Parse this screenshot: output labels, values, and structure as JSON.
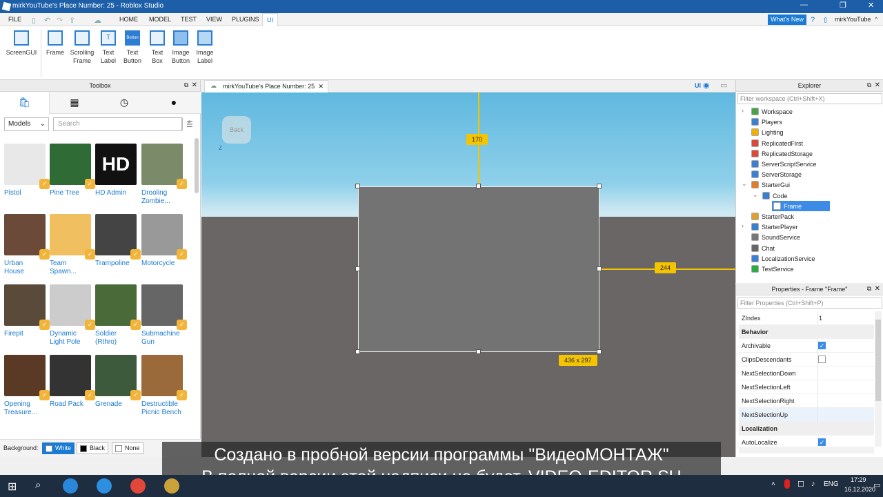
{
  "window": {
    "title": "mirkYouTube's Place Number: 25 - Roblox Studio",
    "minimize": "—",
    "restore": "❐",
    "close": "✕"
  },
  "menubar": {
    "items": [
      "FILE",
      "HOME",
      "MODEL",
      "TEST",
      "VIEW",
      "PLUGINS",
      "UI"
    ],
    "whats_new": "What's New",
    "user": "mirkYouTube"
  },
  "ribbon": {
    "buttons": [
      {
        "label1": "ScreenGUI",
        "label2": ""
      },
      {
        "label1": "Frame",
        "label2": ""
      },
      {
        "label1": "Scrolling",
        "label2": "Frame"
      },
      {
        "label1": "Text",
        "label2": "Label"
      },
      {
        "label1": "Text",
        "label2": "Button"
      },
      {
        "label1": "Text",
        "label2": "Box"
      },
      {
        "label1": "Image",
        "label2": "Button"
      },
      {
        "label1": "Image",
        "label2": "Label"
      }
    ],
    "text_button_icon_text": "Button"
  },
  "toolbox": {
    "title": "Toolbox",
    "category": "Models",
    "search_placeholder": "Search",
    "items": [
      {
        "label": "Pistol",
        "label2": ""
      },
      {
        "label": "Pine Tree",
        "label2": ""
      },
      {
        "label": "HD Admin",
        "label2": ""
      },
      {
        "label": "Drooling",
        "label2": "Zombie..."
      },
      {
        "label": "Urban",
        "label2": "House"
      },
      {
        "label": "Team",
        "label2": "Spawn..."
      },
      {
        "label": "Trampoline",
        "label2": ""
      },
      {
        "label": "Motorcycle",
        "label2": ""
      },
      {
        "label": "Firepit",
        "label2": ""
      },
      {
        "label": "Dynamic",
        "label2": "Light Pole"
      },
      {
        "label": "Soldier",
        "label2": "(Rthro)"
      },
      {
        "label": "Submachine",
        "label2": "Gun"
      },
      {
        "label": "Opening",
        "label2": "Treasure..."
      },
      {
        "label": "Road Pack",
        "label2": ""
      },
      {
        "label": "Grenade",
        "label2": ""
      },
      {
        "label": "Destructible",
        "label2": "Picnic Bench"
      }
    ],
    "hd_text": "HD",
    "background_label": "Background:",
    "bg_options": [
      "White",
      "Black",
      "None"
    ]
  },
  "viewport": {
    "tab_title": "mirkYouTube's Place Number: 25",
    "back_text": "Back",
    "axis_z": "Z",
    "top_distance": "170",
    "right_distance": "244",
    "size_label": "436 x 297",
    "ui_toggle": "UI"
  },
  "explorer": {
    "title": "Explorer",
    "filter_placeholder": "Filter workspace (Ctrl+Shift+X)",
    "items": [
      {
        "label": "Workspace",
        "color": "#4aa34a"
      },
      {
        "label": "Players",
        "color": "#3c7fd1"
      },
      {
        "label": "Lighting",
        "color": "#f0b000"
      },
      {
        "label": "ReplicatedFirst",
        "color": "#d84a3a"
      },
      {
        "label": "ReplicatedStorage",
        "color": "#d84a3a"
      },
      {
        "label": "ServerScriptService",
        "color": "#3c7fd1"
      },
      {
        "label": "ServerStorage",
        "color": "#3c7fd1"
      },
      {
        "label": "StarterGui",
        "color": "#e07b2a"
      },
      {
        "label": "Code",
        "color": "#3c7fd1"
      },
      {
        "label": "Frame",
        "color": "#ffffff"
      },
      {
        "label": "StarterPack",
        "color": "#e0a030"
      },
      {
        "label": "StarterPlayer",
        "color": "#3c7fd1"
      },
      {
        "label": "SoundService",
        "color": "#777777"
      },
      {
        "label": "Chat",
        "color": "#666666"
      },
      {
        "label": "LocalizationService",
        "color": "#3c7fd1"
      },
      {
        "label": "TestService",
        "color": "#2eaa44"
      }
    ]
  },
  "properties": {
    "title": "Properties - Frame \"Frame\"",
    "filter_placeholder": "Filter Properties (Ctrl+Shift+P)",
    "rows": [
      {
        "name": "ZIndex",
        "value": "1"
      },
      {
        "name": "Behavior",
        "value": ""
      },
      {
        "name": "Archivable",
        "value": ""
      },
      {
        "name": "ClipsDescendants",
        "value": ""
      },
      {
        "name": "NextSelectionDown",
        "value": ""
      },
      {
        "name": "NextSelectionLeft",
        "value": ""
      },
      {
        "name": "NextSelectionRight",
        "value": ""
      },
      {
        "name": "NextSelectionUp",
        "value": ""
      },
      {
        "name": "Localization",
        "value": ""
      },
      {
        "name": "AutoLocalize",
        "value": ""
      }
    ],
    "archivable": true,
    "clips_descendants": false,
    "auto_localize": true
  },
  "watermark": {
    "line1": "Создано в пробной версии программы \"ВидеоМОНТАЖ\"",
    "line2": "В полной версии этой надписи не будет. VIDEO-EDITOR.SU"
  },
  "taskbar": {
    "language": "ENG",
    "time": "17:29",
    "date": "16.12.2020"
  },
  "colors": {
    "accent": "#1b7ad1",
    "selection": "#f5c400",
    "badge": "#f2b53a"
  }
}
